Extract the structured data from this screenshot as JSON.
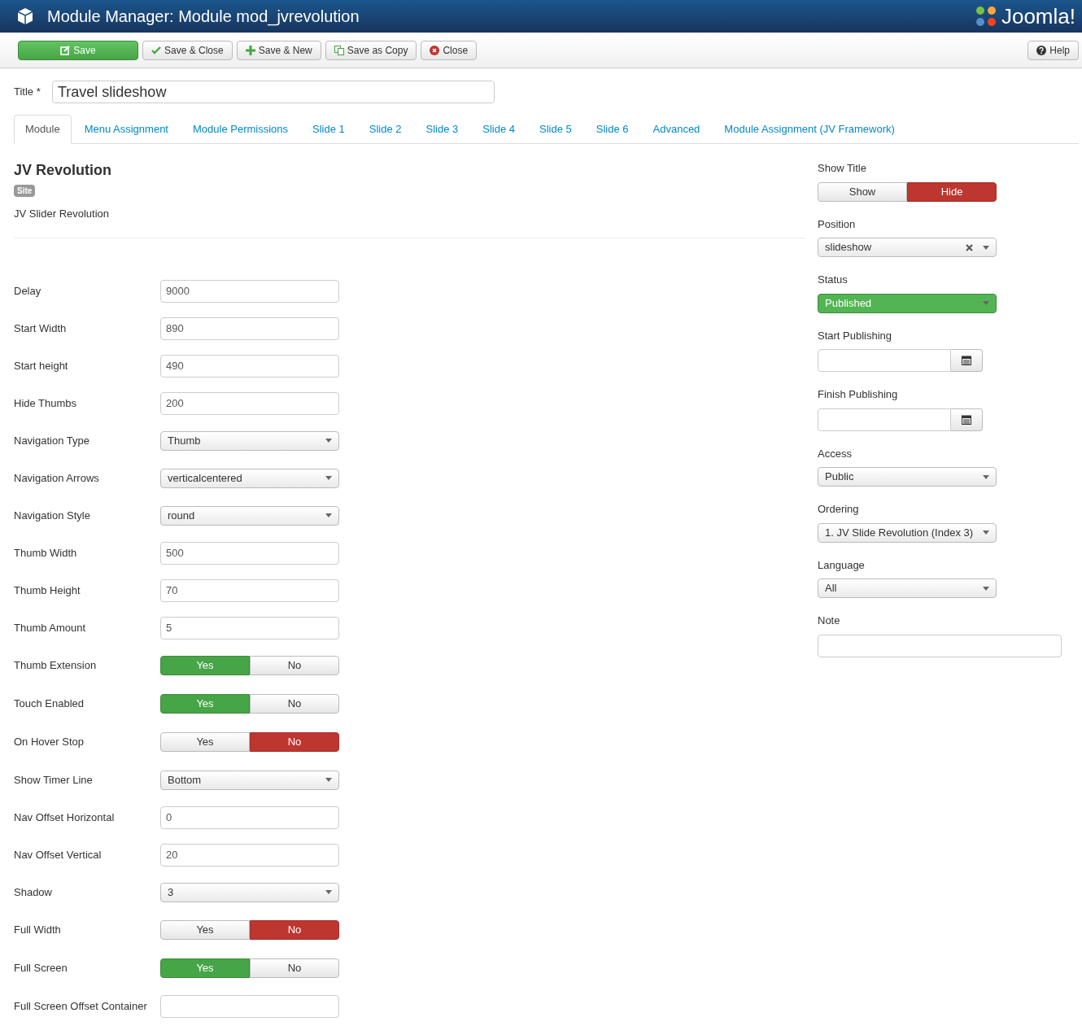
{
  "header": {
    "title": "Module Manager: Module mod_jvrevolution",
    "logo": "Joomla!"
  },
  "toolbar": {
    "buttons": [
      {
        "label": "Save",
        "kind": "primary"
      },
      {
        "label": "Save & Close",
        "kind": "default"
      },
      {
        "label": "Save & New",
        "kind": "default"
      },
      {
        "label": "Save as Copy",
        "kind": "default"
      },
      {
        "label": "Close",
        "kind": "default"
      }
    ],
    "help": "Help"
  },
  "title_field": {
    "label": "Title *",
    "value": "Travel slideshow"
  },
  "tabs": [
    {
      "label": "Module",
      "selected": true
    },
    {
      "label": "Menu Assignment",
      "selected": false
    },
    {
      "label": "Module Permissions",
      "selected": false
    },
    {
      "label": "Slide 1",
      "selected": false
    },
    {
      "label": "Slide 2",
      "selected": false
    },
    {
      "label": "Slide 3",
      "selected": false
    },
    {
      "label": "Slide 4",
      "selected": false
    },
    {
      "label": "Slide 5",
      "selected": false
    },
    {
      "label": "Slide 6",
      "selected": false
    },
    {
      "label": "Advanced",
      "selected": false
    },
    {
      "label": "Module Assignment (JV Framework)",
      "selected": false
    }
  ],
  "module": {
    "name": "JV Revolution",
    "badge": "Site",
    "description": "JV Slider Revolution"
  },
  "fields": [
    {
      "label": "Delay",
      "kind": "text",
      "value": "9000"
    },
    {
      "label": "Start Width",
      "kind": "text",
      "value": "890"
    },
    {
      "label": "Start height",
      "kind": "text",
      "value": "490"
    },
    {
      "label": "Hide Thumbs",
      "kind": "text",
      "value": "200"
    },
    {
      "label": "Navigation Type",
      "kind": "select",
      "value": "Thumb"
    },
    {
      "label": "Navigation Arrows",
      "kind": "select",
      "value": "verticalcentered"
    },
    {
      "label": "Navigation Style",
      "kind": "select",
      "value": "round"
    },
    {
      "label": "Thumb Width",
      "kind": "text",
      "value": "500"
    },
    {
      "label": "Thumb Height",
      "kind": "text",
      "value": "70"
    },
    {
      "label": "Thumb Amount",
      "kind": "text",
      "value": "5"
    },
    {
      "label": "Thumb Extension",
      "kind": "toggle",
      "options": [
        {
          "label": "Yes",
          "selected": true
        },
        {
          "label": "No",
          "selected": false
        }
      ]
    },
    {
      "label": "Touch Enabled",
      "kind": "toggle",
      "options": [
        {
          "label": "Yes",
          "selected": true
        },
        {
          "label": "No",
          "selected": false
        }
      ]
    },
    {
      "label": "On Hover Stop",
      "kind": "toggle",
      "options": [
        {
          "label": "Yes",
          "selected": false
        },
        {
          "label": "No",
          "selected": true
        }
      ]
    },
    {
      "label": "Show Timer Line",
      "kind": "select",
      "value": "Bottom"
    },
    {
      "label": "Nav Offset Horizontal",
      "kind": "text",
      "value": "0"
    },
    {
      "label": "Nav Offset Vertical",
      "kind": "text",
      "value": "20"
    },
    {
      "label": "Shadow",
      "kind": "select",
      "value": "3"
    },
    {
      "label": "Full Width",
      "kind": "toggle",
      "options": [
        {
          "label": "Yes",
          "selected": false
        },
        {
          "label": "No",
          "selected": true
        }
      ]
    },
    {
      "label": "Full Screen",
      "kind": "toggle",
      "options": [
        {
          "label": "Yes",
          "selected": true
        },
        {
          "label": "No",
          "selected": false
        }
      ]
    },
    {
      "label": "Full Screen Offset Container",
      "kind": "text"
    }
  ],
  "side_fields": [
    {
      "label": "Show Title",
      "kind": "toggle",
      "options": [
        {
          "label": "Show",
          "selected": false
        },
        {
          "label": "Hide",
          "selected": true
        }
      ]
    },
    {
      "label": "Position",
      "kind": "clearable",
      "value": "slideshow"
    },
    {
      "label": "Status",
      "kind": "status",
      "value": "Published"
    },
    {
      "label": "Start Publishing",
      "kind": "date"
    },
    {
      "label": "Finish Publishing",
      "kind": "date"
    },
    {
      "label": "Access",
      "kind": "select",
      "value": "Public"
    },
    {
      "label": "Ordering",
      "kind": "select",
      "value": "1. JV Slide Revolution (Index 3)"
    },
    {
      "label": "Language",
      "kind": "select",
      "value": "All"
    },
    {
      "label": "Note",
      "kind": "wide"
    }
  ]
}
